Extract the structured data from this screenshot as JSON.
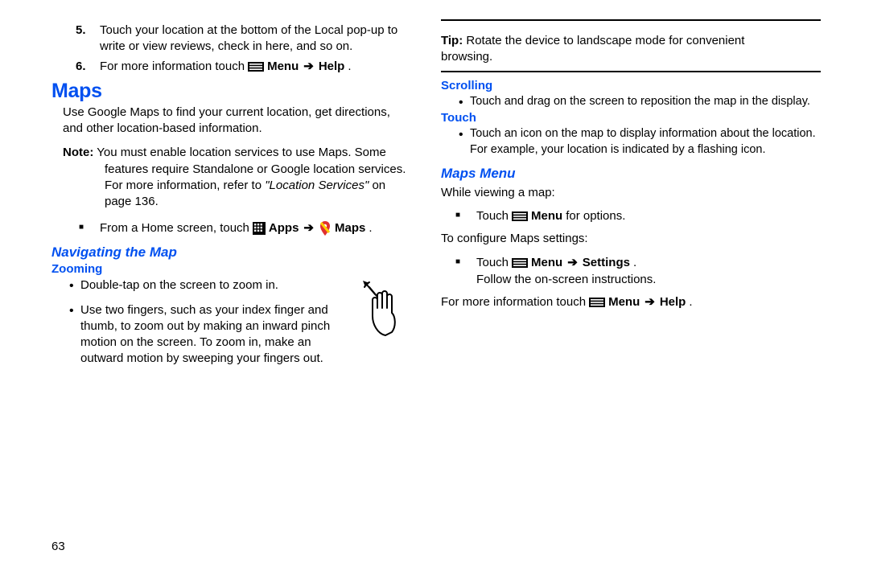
{
  "left": {
    "num5": "Touch your location at the bottom of the Local pop-up to write or view reviews, check in here, and so on.",
    "num6_pre": "For more information touch",
    "num6_menu": "Menu",
    "num6_help": "Help",
    "h1": "Maps",
    "intro": "Use Google Maps to find your current location, get directions, and other location-based information.",
    "note_label": "Note:",
    "note_body1": " You must enable location services to use Maps. Some ",
    "note_body2": "features require Standalone or Google location services. For more information, refer to ",
    "note_refital": "\"Location Services\"",
    "note_body3": " on page 136.",
    "home_pre": "From a Home screen, touch",
    "home_apps": "Apps",
    "home_maps": "Maps",
    "h2_nav": "Navigating the Map",
    "h3_zoom": "Zooming",
    "zoom_b1": "Double-tap on the screen to zoom in.",
    "zoom_b2": "Use two fingers, such as your index finger and thumb, to zoom out by making an inward pinch motion on the screen. To zoom in, make an outward motion by sweeping your fingers out."
  },
  "right": {
    "tip_label": "Tip:",
    "tip_body1": " Rotate the device to landscape mode for convenient ",
    "tip_body2": "browsing.",
    "h3_scroll": "Scrolling",
    "scroll_b1": "Touch and drag on the screen to reposition the map in the display.",
    "h3_touch": "Touch",
    "touch_b1": "Touch an icon on the map to display information about the location. For example, your location is indicated by a flashing icon.",
    "h2_mapsmenu": "Maps Menu",
    "mm_while": "While viewing a map:",
    "mm_touch": "Touch",
    "mm_menu": "Menu",
    "mm_foropts": " for options.",
    "mm_config": "To configure Maps settings:",
    "mm_settings": "Settings",
    "mm_follow": "Follow the on-screen instructions.",
    "mm_more_pre": "For more information touch",
    "mm_help": "Help"
  },
  "pagenum": "63"
}
